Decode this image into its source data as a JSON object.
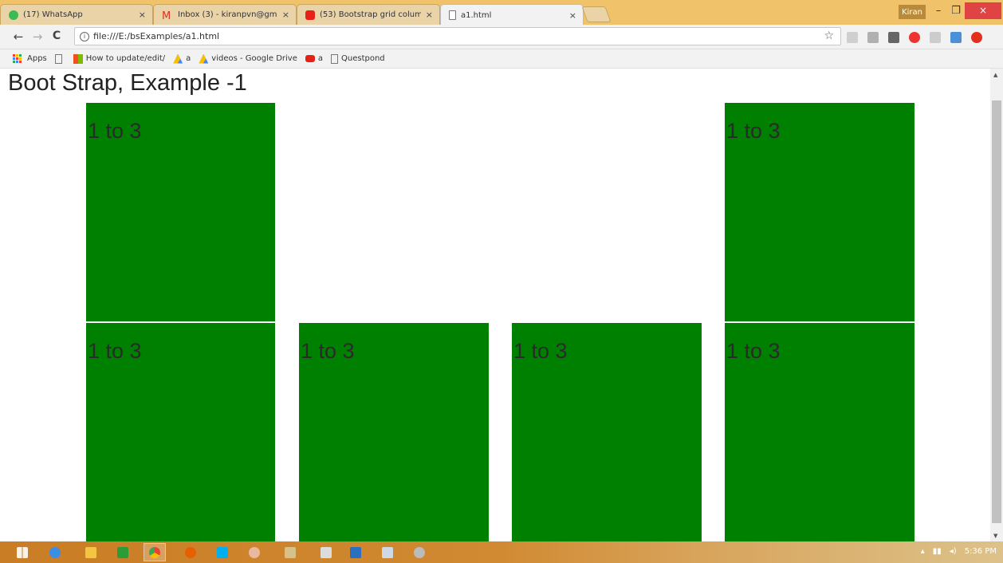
{
  "browser": {
    "tabs": [
      {
        "label": "(17) WhatsApp",
        "icon": "whatsapp-icon",
        "color": "#3cba54",
        "active": false
      },
      {
        "label": "Inbox (3) - kiranpvn@gm",
        "icon": "gmail-icon",
        "color": "#d93025",
        "active": false
      },
      {
        "label": "(53) Bootstrap grid colum",
        "icon": "youtube-icon",
        "color": "#e62117",
        "active": false
      },
      {
        "label": "a1.html",
        "icon": "page-icon",
        "color": "#ffffff",
        "active": true
      }
    ],
    "close_glyph": "×",
    "user_label": "Kiran",
    "window_controls": {
      "minimize": "–",
      "restore": "❐",
      "close": "×"
    },
    "nav": {
      "back": "←",
      "forward": "→",
      "reload": "C"
    },
    "address": "file:///E:/bsExamples/a1.html",
    "info_glyph": "i",
    "star_glyph": "☆",
    "bookmarks": {
      "apps": "Apps",
      "items": [
        {
          "label": "",
          "icon": "page-icon"
        },
        {
          "label": "How to update/edit/",
          "icon": "windows-icon"
        },
        {
          "label": "a",
          "icon": "google-drive-icon"
        },
        {
          "label": "videos - Google Drive",
          "icon": "google-drive-icon"
        },
        {
          "label": "a",
          "icon": "youtube-icon"
        },
        {
          "label": "Questpond",
          "icon": "page-icon"
        }
      ]
    }
  },
  "page": {
    "title": "Boot Strap, Example -1",
    "box_color": "#008000",
    "row1": [
      {
        "label": "1 to 3"
      },
      {
        "label": "1 to 3"
      }
    ],
    "row2": [
      {
        "label": "1 to 3"
      },
      {
        "label": "1 to 3"
      },
      {
        "label": "1 to 3"
      },
      {
        "label": "1 to 3"
      }
    ]
  },
  "taskbar": {
    "time": "5:36 PM"
  }
}
